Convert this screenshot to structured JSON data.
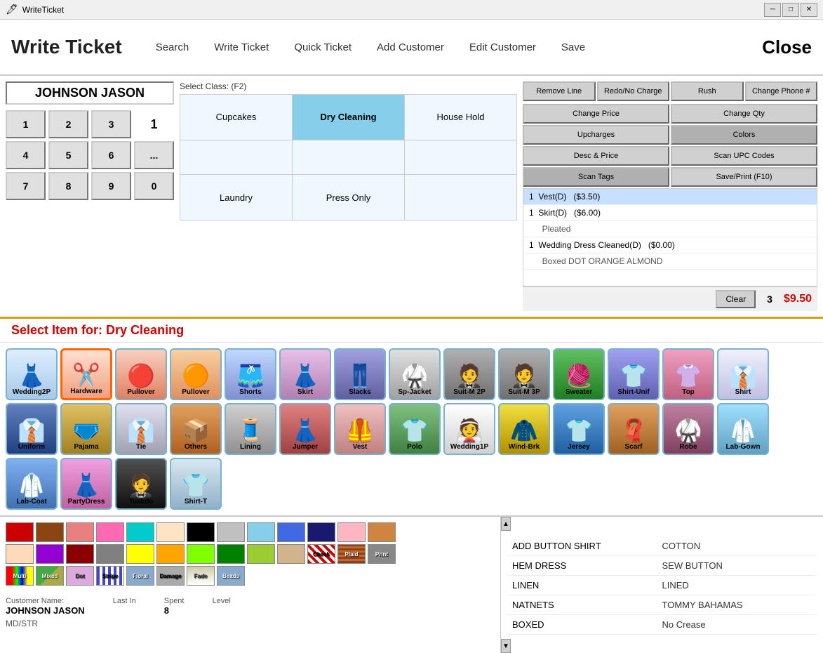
{
  "titleBar": {
    "title": "WriteTicket",
    "controls": [
      "minimize",
      "maximize",
      "close"
    ]
  },
  "header": {
    "appTitle": "Write Ticket",
    "navItems": [
      "Search",
      "Write Ticket",
      "Quick Ticket",
      "Add Customer",
      "Edit Customer",
      "Save",
      "Close"
    ]
  },
  "customerName": "JOHNSON JASON",
  "selectClassLabel": "Select Class: (F2)",
  "classes": [
    {
      "label": "Cupcakes",
      "active": false
    },
    {
      "label": "Dry Cleaning",
      "active": true
    },
    {
      "label": "House Hold",
      "active": false
    },
    {
      "label": "",
      "active": false
    },
    {
      "label": "",
      "active": false
    },
    {
      "label": "",
      "active": false
    },
    {
      "label": "Laundry",
      "active": false
    },
    {
      "label": "Press Only",
      "active": false
    },
    {
      "label": "",
      "active": false
    }
  ],
  "numpad": {
    "buttons": [
      "1",
      "2",
      "3",
      "4",
      "5",
      "6",
      "7",
      "8",
      "9",
      "0",
      "..."
    ],
    "display": "1"
  },
  "actionButtons": [
    "Remove Line",
    "Redo/No Charge",
    "Rush",
    "Change Phone #",
    "Change Price",
    "",
    "",
    "",
    "Change Qty",
    "",
    "",
    "",
    "Upcharges",
    "",
    "",
    "",
    "Colors",
    "",
    "",
    "",
    "Desc & Price",
    "",
    "",
    "",
    "Scan UPC Codes",
    "",
    "",
    "",
    "Scan Tags",
    "",
    "",
    "",
    "Save/Print (F10)",
    "",
    "",
    ""
  ],
  "actionButtonsSimple": [
    {
      "label": "Remove Line",
      "wide": false
    },
    {
      "label": "Redo/No Charge",
      "wide": false
    },
    {
      "label": "Rush",
      "wide": false
    },
    {
      "label": "Change Phone #",
      "wide": false
    },
    {
      "label": "Change Price",
      "wide": false
    },
    {
      "label": "Change Qty",
      "wide": false
    },
    {
      "label": "Upcharges",
      "wide": false
    },
    {
      "label": "Colors",
      "wide": false
    },
    {
      "label": "Desc & Price",
      "wide": false
    },
    {
      "label": "Scan UPC Codes",
      "wide": false
    },
    {
      "label": "Scan Tags",
      "wide": false
    },
    {
      "label": "Save/Print (F10)",
      "wide": false
    }
  ],
  "ticketItems": [
    {
      "line": "1",
      "desc": "Vest(D)",
      "price": "($3.50)",
      "highlighted": true,
      "indent": false
    },
    {
      "line": "1",
      "desc": "Skirt(D)",
      "price": "($6.00)",
      "highlighted": false,
      "indent": false
    },
    {
      "line": "",
      "desc": "Pleated",
      "price": "",
      "highlighted": false,
      "indent": true
    },
    {
      "line": "1",
      "desc": "Wedding Dress Cleaned(D)",
      "price": "($0.00)",
      "highlighted": false,
      "indent": false
    },
    {
      "line": "",
      "desc": "Boxed DOT ORANGE ALMOND",
      "price": "",
      "highlighted": false,
      "indent": true
    }
  ],
  "ticketFooter": {
    "clearLabel": "Clear",
    "count": "3",
    "total": "$9.50"
  },
  "selectItemHeader": "Select Item for: Dry Cleaning",
  "items": [
    {
      "label": "Wedding2P",
      "icon": "👗",
      "selected": false
    },
    {
      "label": "Hardware",
      "icon": "✂️",
      "selected": true
    },
    {
      "label": "Pullover",
      "icon": "🧥",
      "selected": false
    },
    {
      "label": "Pullover",
      "icon": "🧥",
      "selected": false
    },
    {
      "label": "Shorts",
      "icon": "🩳",
      "selected": false
    },
    {
      "label": "Skirt",
      "icon": "👗",
      "selected": false
    },
    {
      "label": "Slacks",
      "icon": "👖",
      "selected": false
    },
    {
      "label": "Sp-Jacket",
      "icon": "🥋",
      "selected": false
    },
    {
      "label": "Suit-M 2P",
      "icon": "🤵",
      "selected": false
    },
    {
      "label": "Suit-M 3P",
      "icon": "🤵",
      "selected": false
    },
    {
      "label": "Sweater",
      "icon": "🧶",
      "selected": false
    },
    {
      "label": "Shirt-Unif",
      "icon": "👕",
      "selected": false
    },
    {
      "label": "Top",
      "icon": "👚",
      "selected": false
    },
    {
      "label": "Shirt",
      "icon": "👔",
      "selected": false
    },
    {
      "label": "Uniform",
      "icon": "👔",
      "selected": false
    },
    {
      "label": "Pajama",
      "icon": "🩲",
      "selected": false
    },
    {
      "label": "Tie",
      "icon": "👔",
      "selected": false
    },
    {
      "label": "Others",
      "icon": "📦",
      "selected": false
    },
    {
      "label": "Lining",
      "icon": "🧵",
      "selected": false
    },
    {
      "label": "Jumper",
      "icon": "👗",
      "selected": false
    },
    {
      "label": "Vest",
      "icon": "🦺",
      "selected": false
    },
    {
      "label": "Polo",
      "icon": "👕",
      "selected": false
    },
    {
      "label": "Wedding1P",
      "icon": "👰",
      "selected": false
    },
    {
      "label": "Wind-Brk",
      "icon": "🧥",
      "selected": false
    },
    {
      "label": "Jersey",
      "icon": "👕",
      "selected": false
    },
    {
      "label": "Scarf",
      "icon": "🧣",
      "selected": false
    },
    {
      "label": "Robe",
      "icon": "🥋",
      "selected": false
    },
    {
      "label": "Lab-Gown",
      "icon": "🥼",
      "selected": false
    },
    {
      "label": "Lab-Coat",
      "icon": "🥼",
      "selected": false
    },
    {
      "label": "PartyDress",
      "icon": "👗",
      "selected": false
    },
    {
      "label": "Tuxedo",
      "icon": "🤵",
      "selected": false
    },
    {
      "label": "Shirt-T",
      "icon": "👕",
      "selected": false
    }
  ],
  "colors": {
    "swatches": [
      "#cc0000",
      "#8B4513",
      "#e88080",
      "#ff69b4",
      "#00cccc",
      "#ffe4c4",
      "#000000",
      "#c0c0c0",
      "#87ceeb",
      "#4169e1",
      "#191970",
      "#ffb6c1",
      "#cd853f",
      "#ffdab9",
      "#9400d3",
      "#8b0000",
      "#808080",
      "#ffff00",
      "#ffa500",
      "#7fff00",
      "#008000",
      "#9acd32",
      "#d2b48c"
    ],
    "patterns": [
      {
        "label": "Check",
        "color": "#cc4444"
      },
      {
        "label": "Plaid",
        "color": "#884422"
      },
      {
        "label": "Print",
        "color": "#888888"
      },
      {
        "label": "Multi",
        "color": "#dd44dd"
      },
      {
        "label": "Mixed",
        "color": "#44aa44"
      },
      {
        "label": "Dot",
        "color": "#ddaadd"
      },
      {
        "label": "Stripe",
        "color": "#4444cc"
      },
      {
        "label": "Floral",
        "color": "#88aacc"
      },
      {
        "label": "Damage",
        "color": "#aaaaaa"
      },
      {
        "label": "Fade",
        "color": "#ccccaa"
      },
      {
        "label": "Beads",
        "color": "#88aacc"
      }
    ]
  },
  "options": [
    {
      "left": "ADD BUTTON SHIRT",
      "right": "COTTON"
    },
    {
      "left": "HEM DRESS",
      "right": "SEW BUTTON"
    },
    {
      "left": "LINEN",
      "right": "LINED"
    },
    {
      "left": "NATNETS",
      "right": "TOMMY BAHAMAS"
    },
    {
      "left": "BOXED",
      "right": "No Crease"
    }
  ],
  "customerInfo": {
    "nameLabel": "Customer Name:",
    "name": "JOHNSON JASON",
    "lastInLabel": "Last In",
    "spentLabel": "Spent",
    "spentValue": "8",
    "levelLabel": "Level",
    "extra": "MD/STR"
  }
}
